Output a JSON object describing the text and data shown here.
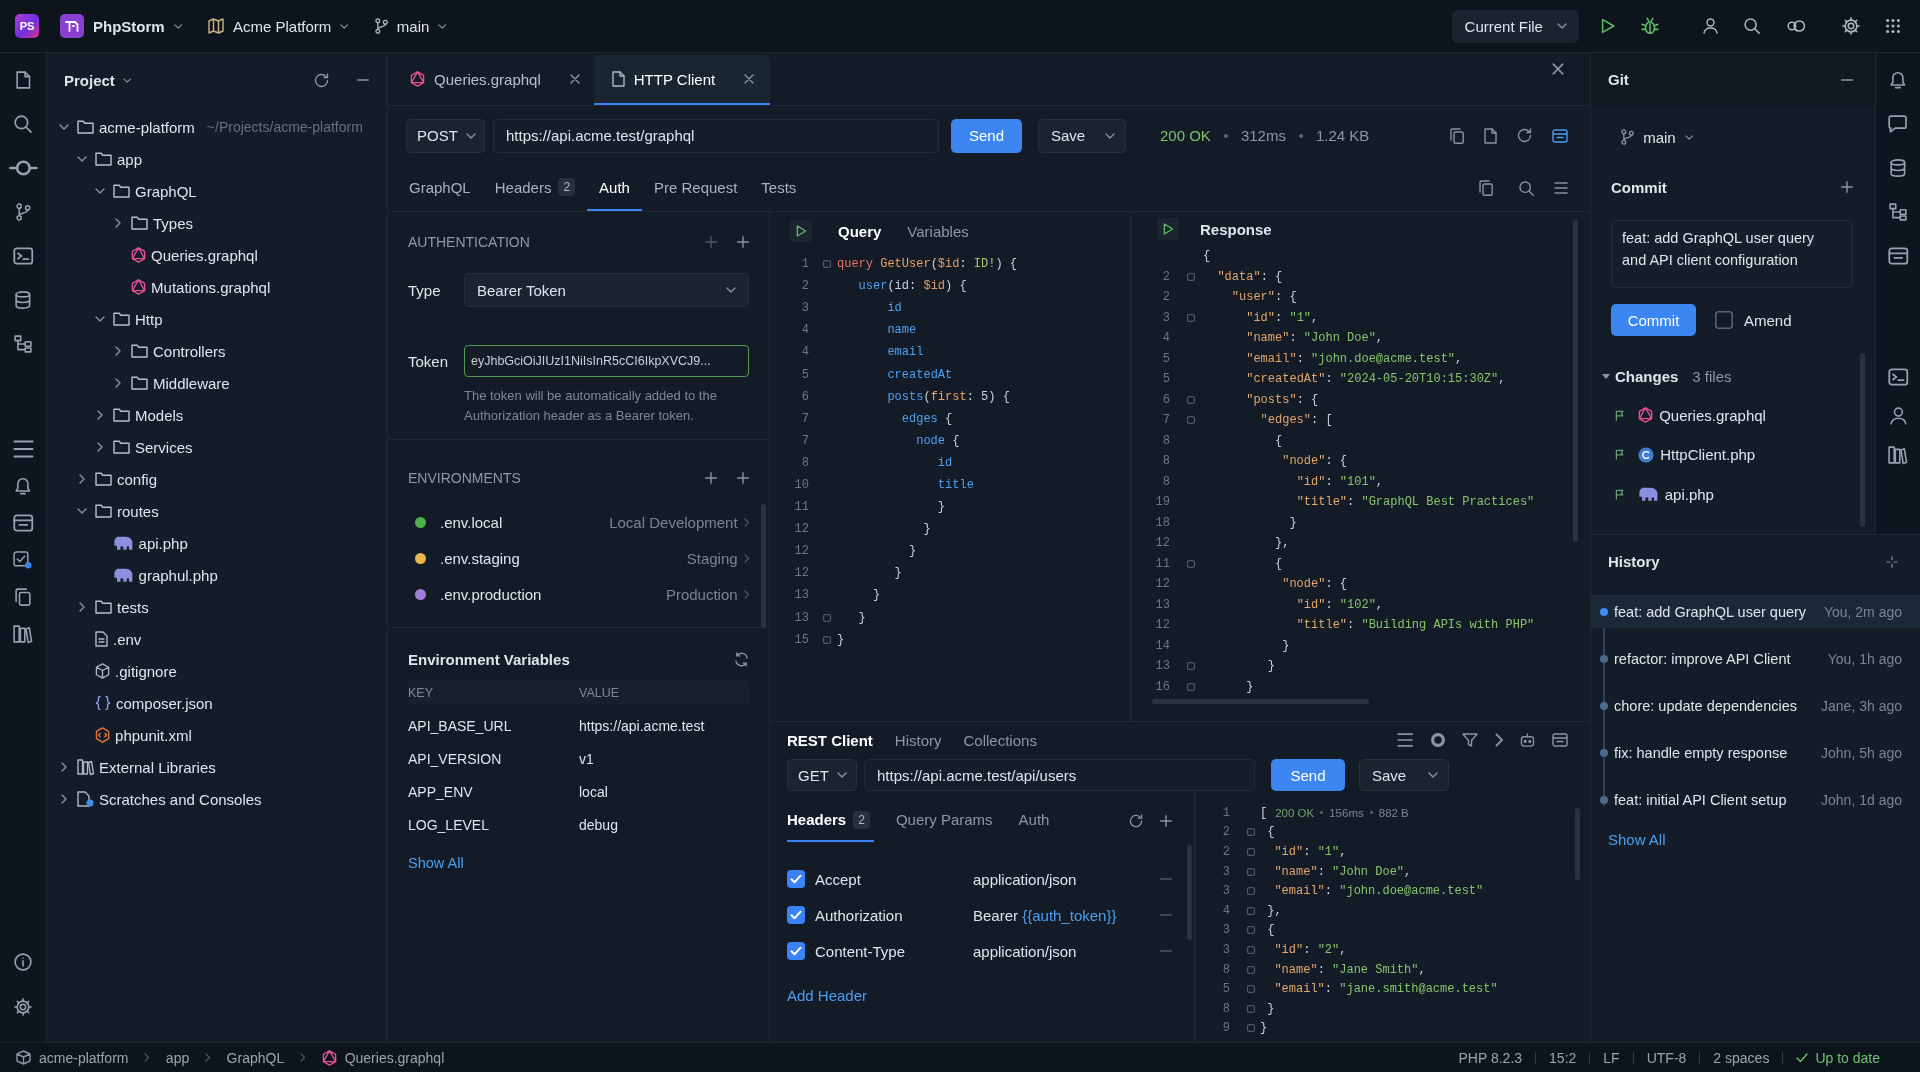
{
  "title_bar": {
    "logo": "PS",
    "app_name": "PhpStorm",
    "project": "Acme Platform",
    "branch": "main",
    "run_config": "Current File"
  },
  "project_panel": {
    "title": "Project",
    "tree": [
      {
        "name": "acme-platform",
        "kind": "folder",
        "expanded": true,
        "path": "~/Projects/acme-platform",
        "children": [
          {
            "name": "app",
            "kind": "folder",
            "expanded": true,
            "children": [
              {
                "name": "GraphQL",
                "kind": "folder",
                "expanded": true,
                "children": [
                  {
                    "name": "Types",
                    "kind": "folder",
                    "expanded": false
                  },
                  {
                    "name": "Queries.graphql",
                    "kind": "graphql"
                  },
                  {
                    "name": "Mutations.graphql",
                    "kind": "graphql"
                  }
                ]
              },
              {
                "name": "Http",
                "kind": "folder",
                "expanded": true,
                "children": [
                  {
                    "name": "Controllers",
                    "kind": "folder",
                    "expanded": false
                  },
                  {
                    "name": "Middleware",
                    "kind": "folder",
                    "expanded": false
                  }
                ]
              },
              {
                "name": "Models",
                "kind": "folder",
                "expanded": false
              },
              {
                "name": "Services",
                "kind": "folder",
                "expanded": false
              }
            ]
          },
          {
            "name": "config",
            "kind": "folder",
            "expanded": false
          },
          {
            "name": "routes",
            "kind": "folder",
            "expanded": true,
            "children": [
              {
                "name": "api.php",
                "kind": "php"
              },
              {
                "name": "graphul.php",
                "kind": "php"
              }
            ]
          },
          {
            "name": "tests",
            "kind": "folder",
            "expanded": false
          },
          {
            "name": ".env",
            "kind": "env"
          },
          {
            "name": ".gitignore",
            "kind": "gitignore"
          },
          {
            "name": "composer.json",
            "kind": "json"
          },
          {
            "name": "phpunit.xml",
            "kind": "xml"
          }
        ]
      },
      {
        "name": "External Libraries",
        "kind": "libraries",
        "expanded": false
      },
      {
        "name": "Scratches and Consoles",
        "kind": "scratches",
        "expanded": false
      }
    ]
  },
  "editor_tabs": [
    {
      "label": "Queries.graphql",
      "kind": "graphql",
      "selected": false
    },
    {
      "label": "HTTP Client",
      "kind": "http",
      "selected": true
    }
  ],
  "request": {
    "method": "POST",
    "url": "https://api.acme.test/graphql",
    "send_label": "Send",
    "save_label": "Save",
    "status": "200 OK",
    "time": "312ms",
    "size": "1.24 KB"
  },
  "request_tabs": [
    {
      "label": "GraphQL",
      "selected": false
    },
    {
      "label": "Headers",
      "count": "2",
      "selected": false
    },
    {
      "label": "Auth",
      "selected": true
    },
    {
      "label": "Pre Request",
      "selected": false
    },
    {
      "label": "Tests",
      "selected": false
    }
  ],
  "auth": {
    "heading": "AUTHENTICATION",
    "type_label": "Type",
    "type_value": "Bearer Token",
    "token_label": "Token",
    "token_value": "eyJhbGciOiJIUzI1NiIsInR5cCI6IkpXVCJ9...",
    "note": "The token will be automatically added to the Authorization header as a Bearer token."
  },
  "environments": {
    "heading": "ENVIRONMENTS",
    "items": [
      {
        "name": ".env.local",
        "description": "Local Development",
        "color": "#4caf50"
      },
      {
        "name": ".env.staging",
        "description": "Staging",
        "color": "#e8b44c"
      },
      {
        "name": ".env.production",
        "description": "Production",
        "color": "#9b7fd9"
      }
    ]
  },
  "env_variables": {
    "title": "Environment Variables",
    "columns": [
      "KEY",
      "VALUE"
    ],
    "rows": [
      [
        "API_BASE_URL",
        "https://api.acme.test"
      ],
      [
        "API_VERSION",
        "v1"
      ],
      [
        "APP_ENV",
        "local"
      ],
      [
        "LOG_LEVEL",
        "debug"
      ]
    ],
    "show_all": "Show All"
  },
  "query_editor": {
    "tabs": [
      {
        "label": "Query",
        "selected": true
      },
      {
        "label": "Variables",
        "selected": false
      }
    ],
    "lines": [
      {
        "number": "1",
        "fold": true,
        "tokens": [
          {
            "kind": "keyword",
            "text": "query"
          },
          {
            "kind": "name",
            "text": " GetUser"
          },
          {
            "kind": "punct",
            "text": "("
          },
          {
            "kind": "variable",
            "text": "$id"
          },
          {
            "kind": "punct",
            "text": ": "
          },
          {
            "kind": "type",
            "text": "ID!"
          },
          {
            "kind": "punct",
            "text": ") {"
          }
        ]
      },
      {
        "number": "2",
        "fold": false,
        "tokens": [
          {
            "kind": "field",
            "text": "   user"
          },
          {
            "kind": "punct",
            "text": "(id: "
          },
          {
            "kind": "variable",
            "text": "$id"
          },
          {
            "kind": "punct",
            "text": ") {"
          }
        ]
      },
      {
        "number": "3",
        "fold": false,
        "tokens": [
          {
            "kind": "field",
            "text": "       id"
          }
        ]
      },
      {
        "number": "4",
        "fold": false,
        "tokens": [
          {
            "kind": "field",
            "text": "       name"
          }
        ]
      },
      {
        "number": "4",
        "fold": false,
        "tokens": [
          {
            "kind": "field",
            "text": "       email"
          }
        ]
      },
      {
        "number": "5",
        "fold": false,
        "tokens": [
          {
            "kind": "field",
            "text": "       createdAt"
          }
        ]
      },
      {
        "number": "6",
        "fold": false,
        "tokens": [
          {
            "kind": "field",
            "text": "       posts"
          },
          {
            "kind": "punct",
            "text": "("
          },
          {
            "kind": "arg",
            "text": "first"
          },
          {
            "kind": "punct",
            "text": ": "
          },
          {
            "kind": "number",
            "text": "5"
          },
          {
            "kind": "punct",
            "text": ") {"
          }
        ]
      },
      {
        "number": "7",
        "fold": false,
        "tokens": [
          {
            "kind": "field",
            "text": "         edges"
          },
          {
            "kind": "punct",
            "text": " {"
          }
        ]
      },
      {
        "number": "7",
        "fold": false,
        "tokens": [
          {
            "kind": "field",
            "text": "           node"
          },
          {
            "kind": "punct",
            "text": " {"
          }
        ]
      },
      {
        "number": "8",
        "fold": false,
        "tokens": [
          {
            "kind": "field",
            "text": "              id"
          }
        ]
      },
      {
        "number": "10",
        "fold": false,
        "tokens": [
          {
            "kind": "field",
            "text": "              title"
          }
        ]
      },
      {
        "number": "11",
        "fold": false,
        "tokens": [
          {
            "kind": "punct",
            "text": "              }"
          }
        ]
      },
      {
        "number": "12",
        "fold": false,
        "tokens": [
          {
            "kind": "punct",
            "text": "            }"
          }
        ]
      },
      {
        "number": "12",
        "fold": false,
        "tokens": [
          {
            "kind": "punct",
            "text": "          }"
          }
        ]
      },
      {
        "number": "12",
        "fold": false,
        "tokens": [
          {
            "kind": "punct",
            "text": "        }"
          }
        ]
      },
      {
        "number": "13",
        "fold": false,
        "tokens": [
          {
            "kind": "punct",
            "text": "     }"
          }
        ]
      },
      {
        "number": "13",
        "fold": true,
        "tokens": [
          {
            "kind": "punct",
            "text": "   }"
          }
        ]
      },
      {
        "number": "15",
        "fold": true,
        "tokens": [
          {
            "kind": "punct",
            "text": "}"
          }
        ]
      }
    ]
  },
  "response_viewer": {
    "title": "Response",
    "lines": [
      {
        "fold": false,
        "tokens": [
          {
            "kind": "punct",
            "text": "{"
          }
        ]
      },
      {
        "number": "2",
        "fold": true,
        "tokens": [
          {
            "kind": "key",
            "text": "  \"data\""
          },
          {
            "kind": "punct",
            "text": ": {"
          }
        ]
      },
      {
        "number": "2",
        "fold": false,
        "tokens": [
          {
            "kind": "key",
            "text": "    \"user\""
          },
          {
            "kind": "punct",
            "text": ": {"
          }
        ]
      },
      {
        "number": "3",
        "fold": true,
        "tokens": [
          {
            "kind": "key",
            "text": "      \"id\""
          },
          {
            "kind": "punct",
            "text": ": "
          },
          {
            "kind": "string",
            "text": "\"1\""
          },
          {
            "kind": "punct",
            "text": ","
          }
        ]
      },
      {
        "number": "4",
        "fold": false,
        "tokens": [
          {
            "kind": "key",
            "text": "      \"name\""
          },
          {
            "kind": "punct",
            "text": ": "
          },
          {
            "kind": "string",
            "text": "\"John Doe\""
          },
          {
            "kind": "punct",
            "text": ","
          }
        ]
      },
      {
        "number": "5",
        "fold": false,
        "tokens": [
          {
            "kind": "key",
            "text": "      \"email\""
          },
          {
            "kind": "punct",
            "text": ": "
          },
          {
            "kind": "string",
            "text": "\"john.doe@acme.test\""
          },
          {
            "kind": "punct",
            "text": ","
          }
        ]
      },
      {
        "number": "5",
        "fold": false,
        "tokens": [
          {
            "kind": "key",
            "text": "      \"createdAt\""
          },
          {
            "kind": "punct",
            "text": ": "
          },
          {
            "kind": "string",
            "text": "\"2024-05-20T10:15:30Z\""
          },
          {
            "kind": "punct",
            "text": ","
          }
        ]
      },
      {
        "number": "6",
        "fold": true,
        "tokens": [
          {
            "kind": "key",
            "text": "      \"posts\""
          },
          {
            "kind": "punct",
            "text": ": {"
          }
        ]
      },
      {
        "number": "7",
        "fold": true,
        "tokens": [
          {
            "kind": "key",
            "text": "        \"edges\""
          },
          {
            "kind": "punct",
            "text": ": ["
          }
        ]
      },
      {
        "number": "8",
        "fold": false,
        "tokens": [
          {
            "kind": "punct",
            "text": "          {"
          }
        ]
      },
      {
        "number": "8",
        "fold": false,
        "tokens": [
          {
            "kind": "key",
            "text": "           \"node\""
          },
          {
            "kind": "punct",
            "text": ": {"
          }
        ]
      },
      {
        "number": "8",
        "fold": false,
        "tokens": [
          {
            "kind": "key",
            "text": "             \"id\""
          },
          {
            "kind": "punct",
            "text": ": "
          },
          {
            "kind": "string",
            "text": "\"101\""
          },
          {
            "kind": "punct",
            "text": ","
          }
        ]
      },
      {
        "number": "19",
        "fold": false,
        "tokens": [
          {
            "kind": "key",
            "text": "             \"title\""
          },
          {
            "kind": "punct",
            "text": ": "
          },
          {
            "kind": "string",
            "text": "\"GraphQL Best Practices\""
          }
        ]
      },
      {
        "number": "18",
        "fold": false,
        "tokens": [
          {
            "kind": "punct",
            "text": "            }"
          }
        ]
      },
      {
        "number": "12",
        "fold": false,
        "tokens": [
          {
            "kind": "punct",
            "text": "          },"
          }
        ]
      },
      {
        "number": "11",
        "fold": true,
        "tokens": [
          {
            "kind": "punct",
            "text": "          {"
          }
        ]
      },
      {
        "number": "12",
        "fold": false,
        "tokens": [
          {
            "kind": "key",
            "text": "           \"node\""
          },
          {
            "kind": "punct",
            "text": ": {"
          }
        ]
      },
      {
        "number": "13",
        "fold": false,
        "tokens": [
          {
            "kind": "key",
            "text": "             \"id\""
          },
          {
            "kind": "punct",
            "text": ": "
          },
          {
            "kind": "string",
            "text": "\"102\""
          },
          {
            "kind": "punct",
            "text": ","
          }
        ]
      },
      {
        "number": "12",
        "fold": false,
        "tokens": [
          {
            "kind": "key",
            "text": "             \"title\""
          },
          {
            "kind": "punct",
            "text": ": "
          },
          {
            "kind": "string",
            "text": "\"Building APIs with PHP\""
          }
        ]
      },
      {
        "number": "14",
        "fold": false,
        "tokens": [
          {
            "kind": "punct",
            "text": "           }"
          }
        ]
      },
      {
        "number": "13",
        "fold": true,
        "tokens": [
          {
            "kind": "punct",
            "text": "         }"
          }
        ]
      },
      {
        "number": "16",
        "fold": true,
        "tokens": [
          {
            "kind": "punct",
            "text": "      }"
          }
        ]
      }
    ]
  },
  "rest_client": {
    "tabs": [
      {
        "label": "REST Client",
        "selected": true
      },
      {
        "label": "History",
        "selected": false
      },
      {
        "label": "Collections",
        "selected": false
      }
    ],
    "method": "GET",
    "url": "https://api.acme.test/api/users",
    "send_label": "Send",
    "save_label": "Save",
    "request_tabs": [
      {
        "label": "Headers",
        "count": "2",
        "selected": true
      },
      {
        "label": "Query Params",
        "selected": false
      },
      {
        "label": "Auth",
        "selected": false
      }
    ],
    "headers": [
      {
        "name": "Accept",
        "value": "application/json",
        "checked": true
      },
      {
        "name": "Authorization",
        "value": "Bearer",
        "variable": "{{auth_token}}",
        "checked": true
      },
      {
        "name": "Content-Type",
        "value": "application/json",
        "checked": true
      }
    ],
    "add_header": "Add Header",
    "response": {
      "status": "200 OK",
      "time": "156ms",
      "size": "882 B",
      "lines": [
        {
          "number": "1",
          "fold": false,
          "tokens": [
            {
              "kind": "punct",
              "text": "["
            }
          ]
        },
        {
          "number": "2",
          "fold": true,
          "tokens": [
            {
              "kind": "punct",
              "text": " {"
            }
          ]
        },
        {
          "number": "2",
          "fold": true,
          "tokens": [
            {
              "kind": "key",
              "text": "  \"id\""
            },
            {
              "kind": "punct",
              "text": ": "
            },
            {
              "kind": "string",
              "text": "\"1\""
            },
            {
              "kind": "punct",
              "text": ","
            }
          ]
        },
        {
          "number": "3",
          "fold": true,
          "tokens": [
            {
              "kind": "key",
              "text": "  \"name\""
            },
            {
              "kind": "punct",
              "text": ": "
            },
            {
              "kind": "string",
              "text": "\"John Doe\""
            },
            {
              "kind": "punct",
              "text": ","
            }
          ]
        },
        {
          "number": "3",
          "fold": true,
          "tokens": [
            {
              "kind": "key",
              "text": "  \"email\""
            },
            {
              "kind": "punct",
              "text": ": "
            },
            {
              "kind": "string",
              "text": "\"john.doe@acme.test\""
            }
          ]
        },
        {
          "number": "4",
          "fold": true,
          "tokens": [
            {
              "kind": "punct",
              "text": " },"
            }
          ]
        },
        {
          "number": "3",
          "fold": true,
          "tokens": [
            {
              "kind": "punct",
              "text": " {"
            }
          ]
        },
        {
          "number": "3",
          "fold": true,
          "tokens": [
            {
              "kind": "key",
              "text": "  \"id\""
            },
            {
              "kind": "punct",
              "text": ": "
            },
            {
              "kind": "string",
              "text": "\"2\""
            },
            {
              "kind": "punct",
              "text": ","
            }
          ]
        },
        {
          "number": "8",
          "fold": true,
          "tokens": [
            {
              "kind": "key",
              "text": "  \"name\""
            },
            {
              "kind": "punct",
              "text": ": "
            },
            {
              "kind": "string",
              "text": "\"Jane Smith\""
            },
            {
              "kind": "punct",
              "text": ","
            }
          ]
        },
        {
          "number": "5",
          "fold": true,
          "tokens": [
            {
              "kind": "key",
              "text": "  \"email\""
            },
            {
              "kind": "punct",
              "text": ": "
            },
            {
              "kind": "string",
              "text": "\"jane.smith@acme.test\""
            }
          ]
        },
        {
          "number": "8",
          "fold": true,
          "tokens": [
            {
              "kind": "punct",
              "text": " }"
            }
          ]
        },
        {
          "number": "9",
          "fold": true,
          "tokens": [
            {
              "kind": "punct",
              "text": "}"
            }
          ]
        }
      ]
    }
  },
  "git": {
    "title": "Git",
    "branch": "main",
    "commit_heading": "Commit",
    "commit_message": "feat: add GraphQL user query and API client configuration",
    "commit_label": "Commit",
    "amend_label": "Amend",
    "amend_checked": false,
    "changes_label": "Changes",
    "changes_count": "3 files",
    "changes_expanded": true,
    "changes": [
      {
        "name": "Queries.graphql",
        "kind": "graphql"
      },
      {
        "name": "HttpClient.php",
        "kind": "class"
      },
      {
        "name": "api.php",
        "kind": "php"
      }
    ]
  },
  "history": {
    "title": "History",
    "entries": [
      {
        "message": "feat: add GraphQL user query",
        "meta": "You, 2m ago",
        "selected": true
      },
      {
        "message": "refactor: improve API Client",
        "meta": "You, 1h ago",
        "selected": false
      },
      {
        "message": "chore: update dependencies",
        "meta": "Jane, 3h ago",
        "selected": false
      },
      {
        "message": "fix: handle empty response",
        "meta": "John, 5h ago",
        "selected": false
      },
      {
        "message": "feat: initial API Client setup",
        "meta": "John, 1d ago",
        "selected": false
      }
    ],
    "show_all": "Show All"
  },
  "status_bar": {
    "breadcrumbs": [
      {
        "label": "acme-platform",
        "kind": "project"
      },
      {
        "label": "app",
        "kind": "folder"
      },
      {
        "label": "GraphQL",
        "kind": "folder"
      },
      {
        "label": "Queries.graphql",
        "kind": "graphql"
      }
    ],
    "items": [
      "PHP 8.2.3",
      "15:2",
      "LF",
      "UTF-8",
      "2 spaces"
    ],
    "vcs_status": "Up to date"
  }
}
